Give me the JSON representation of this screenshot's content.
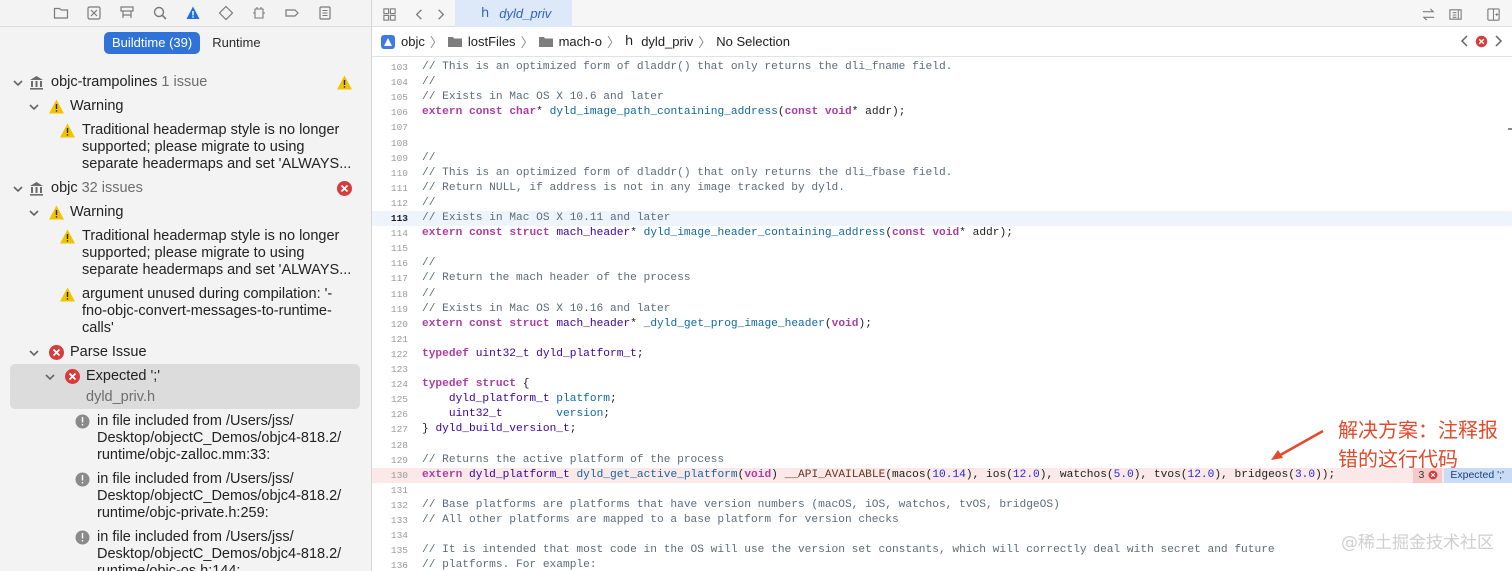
{
  "navigator": {
    "toolbar_icons": [
      "folder-icon",
      "source-control-icon",
      "hierarchy-icon",
      "search-icon",
      "issue-icon",
      "test-icon",
      "debug-icon",
      "breakpoint-icon",
      "report-icon"
    ],
    "segments": {
      "buildtime": "Buildtime (39)",
      "runtime": "Runtime"
    },
    "issues": {
      "g1_title": "objc-trampolines",
      "g1_count": "1 issue",
      "g1_warning": "Warning",
      "g1_w1_l1": "Traditional headermap style is no longer",
      "g1_w1_l2": "supported; please migrate to using",
      "g1_w1_l3": "separate headermaps and set 'ALWAYS...",
      "g2_title": "objc",
      "g2_count": "32 issues",
      "g2_warning": "Warning",
      "g2_w1_l1": "Traditional headermap style is no longer",
      "g2_w1_l2": "supported; please migrate to using",
      "g2_w1_l3": "separate headermaps and set 'ALWAYS...",
      "g2_w2_l1": "argument unused during compilation: '-",
      "g2_w2_l2": "fno-objc-convert-messages-to-runtime-",
      "g2_w2_l3": "calls'",
      "g2_parse": "Parse Issue",
      "g2_err_title": "Expected ';'",
      "g2_err_file": "dyld_priv.h",
      "note1_l1": "in file included from /Users/jss/",
      "note1_l2": "Desktop/objectC_Demos/objc4-818.2/",
      "note1_l3": "runtime/objc-zalloc.mm:33:",
      "note2_l1": "in file included from /Users/jss/",
      "note2_l2": "Desktop/objectC_Demos/objc4-818.2/",
      "note2_l3": "runtime/objc-private.h:259:",
      "note3_l1": "in file included from /Users/jss/",
      "note3_l2": "Desktop/objectC_Demos/objc4-818.2/",
      "note3_l3": "runtime/objc-os.h:144:"
    }
  },
  "editor": {
    "tab": {
      "icon": "h",
      "label": "dyld_priv"
    },
    "jumpbar": [
      "objc",
      "lostFiles",
      "mach-o",
      "dyld_priv",
      "No Selection"
    ],
    "current_line": 113,
    "error_line": 130,
    "error_badge": {
      "count": "3",
      "message": "Expected ';'"
    },
    "lines": [
      {
        "n": 103,
        "t": "// This is an optimized form of dladdr() that only returns the dli_fname field."
      },
      {
        "n": 104,
        "t": "//"
      },
      {
        "n": 105,
        "t": "// Exists in Mac OS X 10.6 and later"
      },
      {
        "n": 106,
        "t": "extern const char* dyld_image_path_containing_address(const void* addr);"
      },
      {
        "n": 107,
        "t": ""
      },
      {
        "n": 108,
        "t": ""
      },
      {
        "n": 109,
        "t": "//"
      },
      {
        "n": 110,
        "t": "// This is an optimized form of dladdr() that only returns the dli_fbase field."
      },
      {
        "n": 111,
        "t": "// Return NULL, if address is not in any image tracked by dyld."
      },
      {
        "n": 112,
        "t": "//"
      },
      {
        "n": 113,
        "t": "// Exists in Mac OS X 10.11 and later"
      },
      {
        "n": 114,
        "t": "extern const struct mach_header* dyld_image_header_containing_address(const void* addr);"
      },
      {
        "n": 115,
        "t": ""
      },
      {
        "n": 116,
        "t": "//"
      },
      {
        "n": 117,
        "t": "// Return the mach header of the process"
      },
      {
        "n": 118,
        "t": "//"
      },
      {
        "n": 119,
        "t": "// Exists in Mac OS X 10.16 and later"
      },
      {
        "n": 120,
        "t": "extern const struct mach_header* _dyld_get_prog_image_header(void);"
      },
      {
        "n": 121,
        "t": ""
      },
      {
        "n": 122,
        "t": "typedef uint32_t dyld_platform_t;"
      },
      {
        "n": 123,
        "t": ""
      },
      {
        "n": 124,
        "t": "typedef struct {"
      },
      {
        "n": 125,
        "t": "    dyld_platform_t platform;"
      },
      {
        "n": 126,
        "t": "    uint32_t        version;"
      },
      {
        "n": 127,
        "t": "} dyld_build_version_t;"
      },
      {
        "n": 128,
        "t": ""
      },
      {
        "n": 129,
        "t": "// Returns the active platform of the process"
      },
      {
        "n": 130,
        "t": "extern dyld_platform_t dyld_get_active_platform(void) __API_AVAILABLE(macos(10.14), ios(12.0), watchos(5.0), tvos(12.0), bridgeos(3.0));"
      },
      {
        "n": 131,
        "t": ""
      },
      {
        "n": 132,
        "t": "// Base platforms are platforms that have version numbers (macOS, iOS, watchos, tvOS, bridgeOS)"
      },
      {
        "n": 133,
        "t": "// All other platforms are mapped to a base platform for version checks"
      },
      {
        "n": 134,
        "t": ""
      },
      {
        "n": 135,
        "t": "// It is intended that most code in the OS will use the version set constants, which will correctly deal with secret and future"
      },
      {
        "n": 136,
        "t": "// platforms. For example:"
      }
    ]
  },
  "annotation": "解决方案：注释报错的这行代码",
  "watermark": "@稀土掘金技术社区",
  "colors": {
    "accent": "#2f72d8",
    "error": "#d93a3a",
    "warning": "#f2c400",
    "annotation": "#e24a2b"
  }
}
